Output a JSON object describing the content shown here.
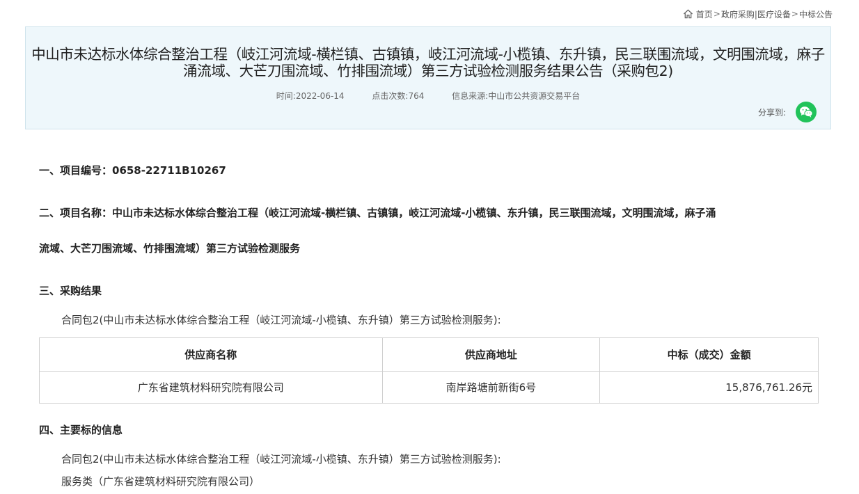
{
  "breadcrumb": {
    "items": [
      "首页",
      "政府采购|医疗设备",
      "中标公告"
    ],
    "separator": ">"
  },
  "header": {
    "title": "中山市未达标水体综合整治工程（岐江河流域-横栏镇、古镇镇，岐江河流域-小榄镇、东升镇，民三联围流域，文明围流域，麻子涌流域、大芒刀围流域、竹排围流域）第三方试验检测服务结果公告（采购包2)",
    "time_label": "时间:",
    "time_value": "2022-06-14",
    "clicks_label": "点击次数:",
    "clicks_value": "764",
    "source_label": "信息来源:",
    "source_value": "中山市公共资源交易平台",
    "share_label": "分享到:"
  },
  "content": {
    "project_number": "一、项目编号：0658-22711B10267",
    "project_name_line1": "二、项目名称：中山市未达标水体综合整治工程（岐江河流域-横栏镇、古镇镇，岐江河流域-小榄镇、东升镇，民三联围流域，文明围流域，麻子涌",
    "project_name_line2": "流域、大芒刀围流域、竹排围流域）第三方试验检测服务",
    "section3_heading": "三、采购结果",
    "section3_package": "合同包2(中山市未达标水体综合整治工程（岐江河流域-小榄镇、东升镇）第三方试验检测服务):",
    "table": {
      "headers": [
        "供应商名称",
        "供应商地址",
        "中标（成交）金额"
      ],
      "rows": [
        [
          "广东省建筑材料研究院有限公司",
          "南岸路塘前新街6号",
          "15,876,761.26元"
        ]
      ]
    },
    "section4_heading": "四、主要标的信息",
    "section4_package": "合同包2(中山市未达标水体综合整治工程（岐江河流域-小榄镇、东升镇）第三方试验检测服务):",
    "section4_service": "服务类（广东省建筑材料研究院有限公司）"
  },
  "colors": {
    "header_bg": "#eef7fb",
    "wechat_green": "#21c35a"
  },
  "icons": {
    "home": "home-icon",
    "share": "wechat-icon"
  }
}
